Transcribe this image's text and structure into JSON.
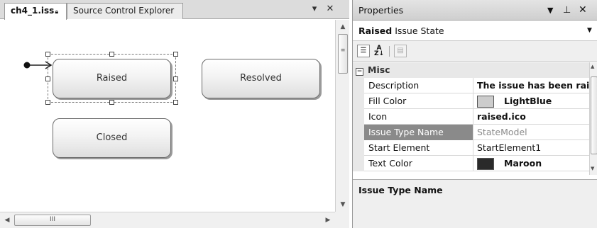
{
  "designer": {
    "tabs": [
      {
        "label": "ch4_1.iss",
        "lock_icon": "lock-icon"
      },
      {
        "label": "Source Control Explorer"
      }
    ],
    "dropdown_icon": "dropdown-arrow-icon",
    "close_icon": "close-icon",
    "states": [
      {
        "label": "Raised",
        "selected": true
      },
      {
        "label": "Resolved",
        "selected": false
      },
      {
        "label": "Closed",
        "selected": false
      }
    ],
    "scrollbar_grip": "III"
  },
  "properties": {
    "title": "Properties",
    "pin_icon": "pin-icon",
    "object": {
      "name": "Raised",
      "type": "Issue State"
    },
    "toolbar": [
      "categorized-icon",
      "alphabetical-icon",
      "property-pages-icon"
    ],
    "category": "Misc",
    "rows": [
      {
        "name": "Description",
        "value": "The issue has been raised",
        "bold": true
      },
      {
        "name": "Fill Color",
        "value": "LightBlue",
        "bold": true,
        "swatch": "#cccccc"
      },
      {
        "name": "Icon",
        "value": "raised.ico",
        "bold": true
      },
      {
        "name": "Issue Type Name",
        "value": "StateModel",
        "bold": false,
        "selected": true,
        "dim": true
      },
      {
        "name": "Start Element",
        "value": "StartElement1",
        "bold": false
      },
      {
        "name": "Text Color",
        "value": "Maroon",
        "bold": true,
        "swatch": "#2a2a2a"
      }
    ],
    "description_title": "Issue Type Name"
  }
}
